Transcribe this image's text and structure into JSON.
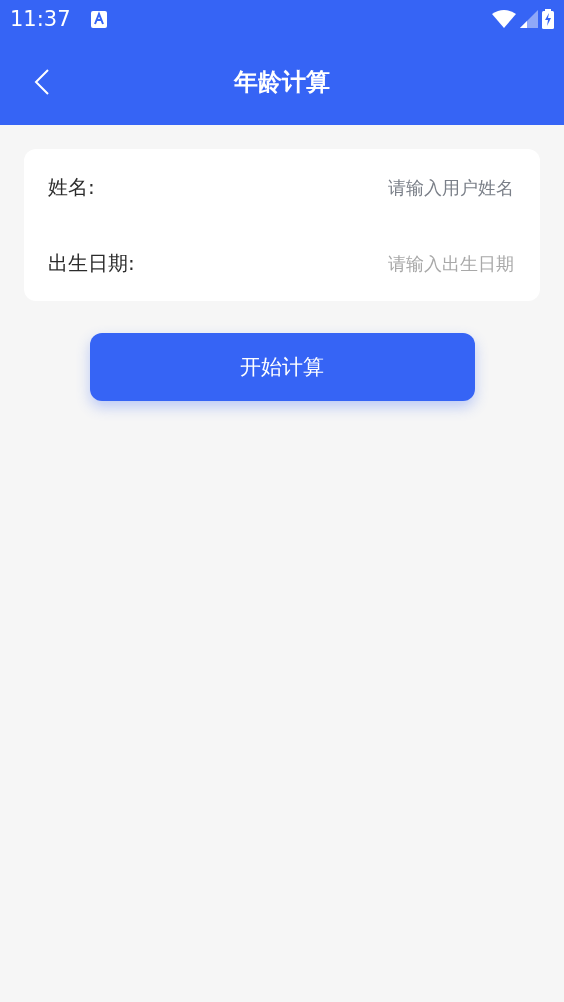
{
  "status_bar": {
    "time": "11:37"
  },
  "header": {
    "title": "年龄计算"
  },
  "form": {
    "fields": [
      {
        "kind": "text",
        "label": "姓名:",
        "placeholder": "请输入用户姓名"
      },
      {
        "kind": "date",
        "label": "出生日期:",
        "placeholder": "请输入出生日期"
      }
    ]
  },
  "submit_button": "开始计算"
}
